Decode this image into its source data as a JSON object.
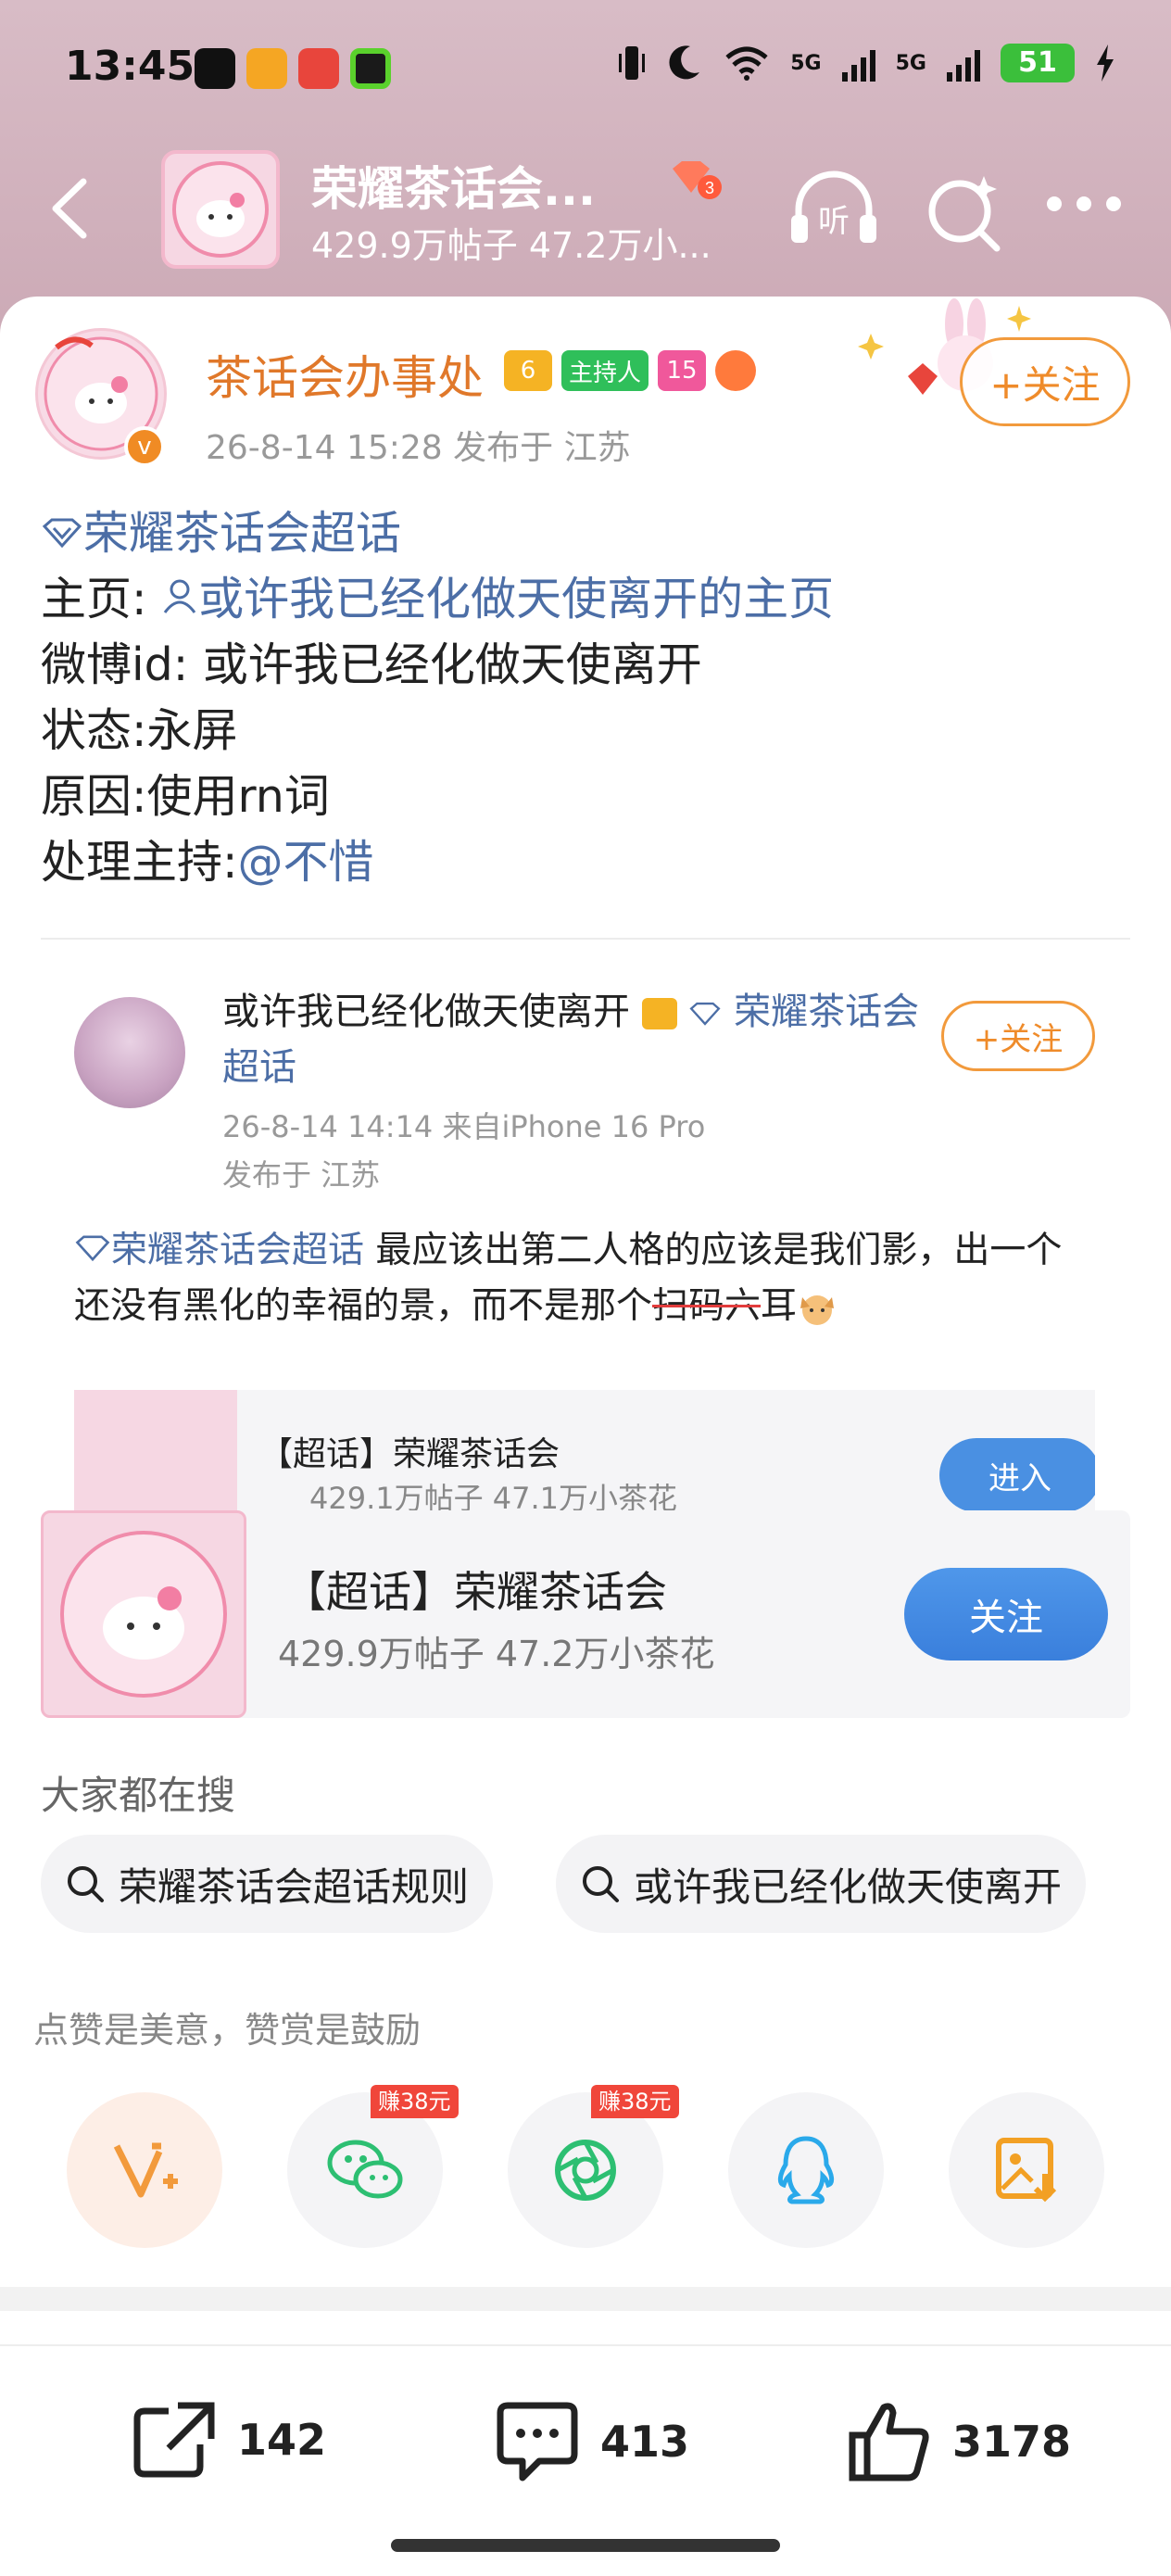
{
  "status_bar": {
    "time": "13:45",
    "battery": "51",
    "net1": "5G",
    "net2": "5G"
  },
  "header": {
    "title": "荣耀茶话会...",
    "subtitle": "429.9万帖子 47.2万小...",
    "badge_level": "3",
    "listen_label": "听"
  },
  "post": {
    "author": "茶话会办事处",
    "badges": {
      "crown_level": "6",
      "host_label": "主持人",
      "diamond_level": "15"
    },
    "meta": "26-8-14 15:28  发布于 江苏",
    "follow_label": "+关注",
    "lines": {
      "topic": "荣耀茶话会超话",
      "home_prefix": "主页: ",
      "home_link": "或许我已经化做天使离开的主页",
      "weibo_id": "微博id: 或许我已经化做天使离开",
      "status": "状态:永屏",
      "reason": "原因:使用rn词",
      "handler_prefix": "处理主持:",
      "handler_link": "@不惜"
    }
  },
  "repost": {
    "author": "或许我已经化做天使离开",
    "topic_link": "荣耀茶话会超话",
    "follow_label": "+关注",
    "meta_line1": "26-8-14 14:14  来自iPhone 16 Pro",
    "meta_line2": "发布于 江苏",
    "text_topic": "荣耀茶话会超话",
    "text_part1": "  最应该出第二人格的应该是我们影，出一个还没有黑化的幸福的景，而不是那个",
    "text_strike": "扫码六",
    "text_part2": "耳",
    "mini_card": {
      "title": "【超话】荣耀茶话会",
      "sub": "429.1万帖子 47.1万小茶花",
      "button": "进入"
    }
  },
  "topic_card": {
    "title": "【超话】荣耀茶话会",
    "sub": "429.9万帖子 47.2万小茶花",
    "button": "关注"
  },
  "search": {
    "heading": "大家都在搜",
    "chips": [
      "荣耀茶话会超话规则",
      "或许我已经化做天使离开"
    ]
  },
  "reward": {
    "text": "点赞是美意，赞赏是鼓励",
    "wechat_tag": "赚38元",
    "moments_tag": "赚38元"
  },
  "actions": {
    "share_count": "142",
    "comment_count": "413",
    "like_count": "3178"
  },
  "colors": {
    "accent_orange": "#ef8b2a",
    "link_blue": "#4c6ea6",
    "button_blue": "#4a90e2",
    "header_bg": "#d8bcc6"
  }
}
